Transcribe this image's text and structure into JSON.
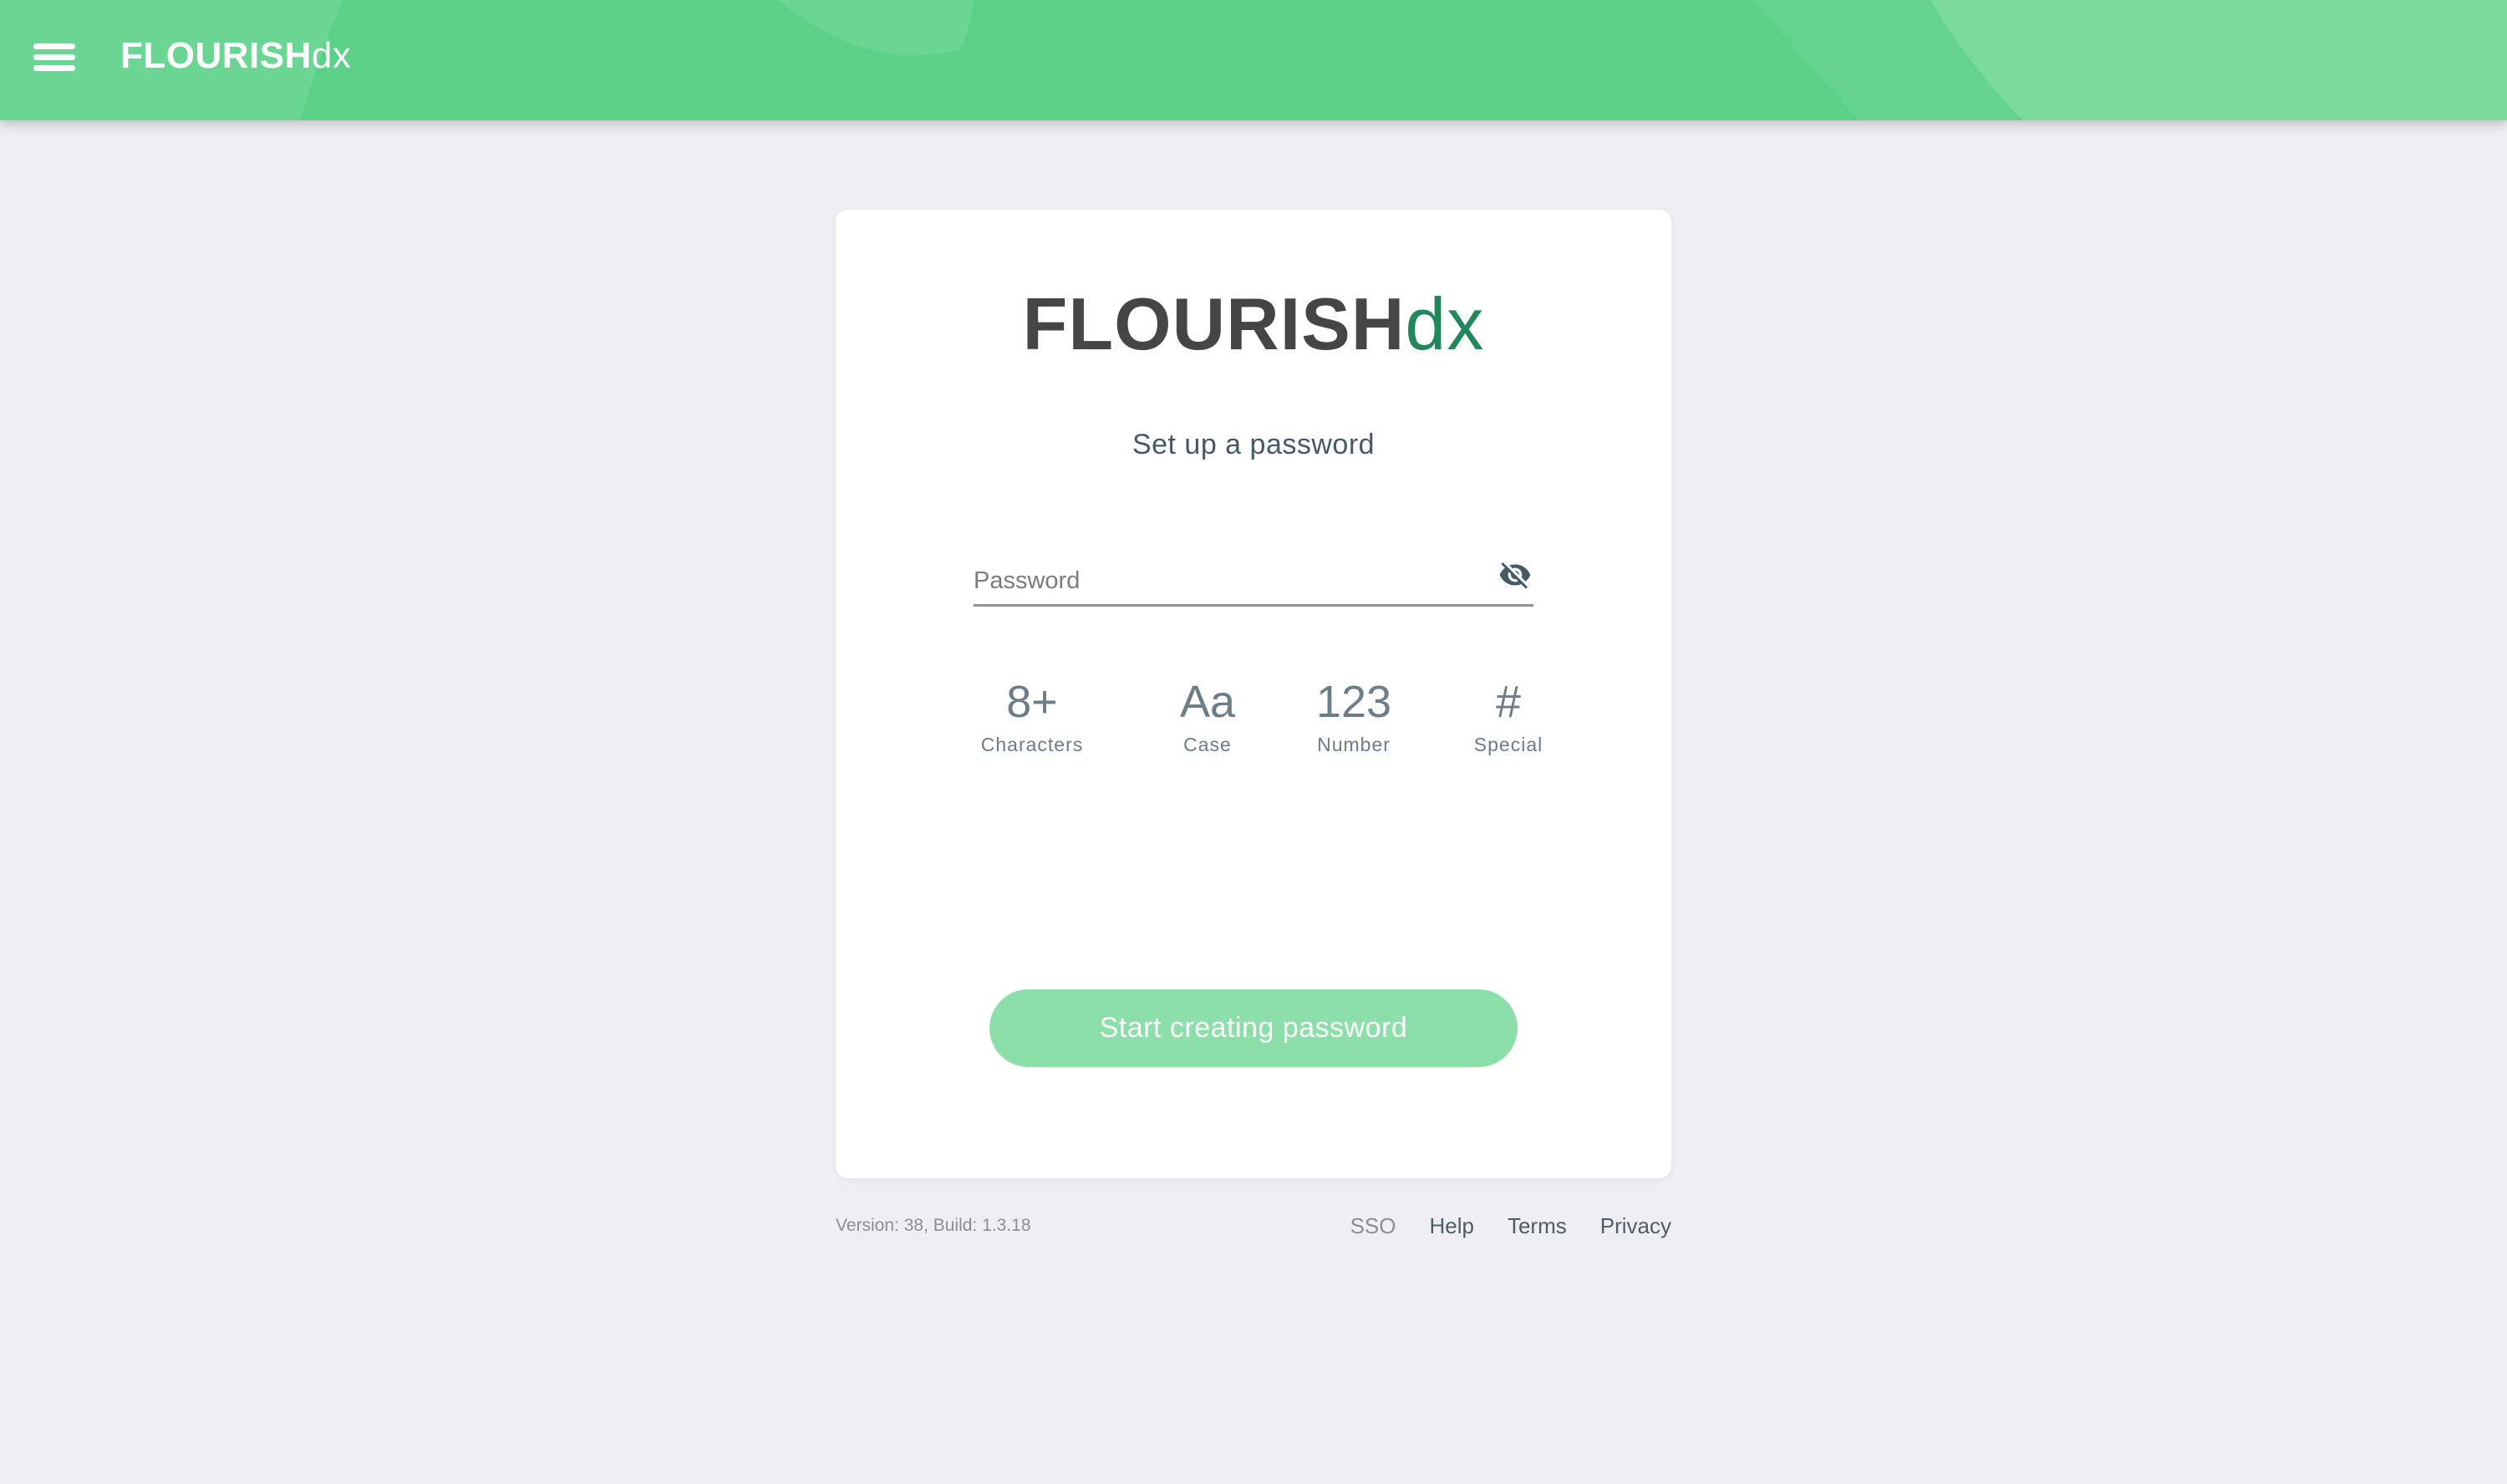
{
  "header": {
    "logo_bold": "FLOURISH",
    "logo_light": "dx",
    "menu_icon": "hamburger-menu-icon",
    "colors": {
      "base": "#5ad187",
      "blob_light": "#6bd693",
      "blob_lighter": "#7adb9c"
    }
  },
  "card": {
    "logo_bold": "FLOURISH",
    "logo_light": "dx",
    "logo_colors": {
      "bold": "#454545",
      "light": "#22875a"
    },
    "subtitle": "Set up a password",
    "password_field": {
      "placeholder": "Password",
      "value": "",
      "toggle_icon": "eye-off-icon"
    },
    "requirements": [
      {
        "symbol": "8+",
        "label": "Characters"
      },
      {
        "symbol": "Aa",
        "label": "Case"
      },
      {
        "symbol": "123",
        "label": "Number"
      },
      {
        "symbol": "#",
        "label": "Special"
      }
    ],
    "start_button": {
      "label": "Start creating password",
      "color": "#8ddfa9"
    }
  },
  "footer": {
    "version": "Version: 38, Build: 1.3.18",
    "links": [
      {
        "label": "SSO"
      },
      {
        "label": "Help"
      },
      {
        "label": "Terms"
      },
      {
        "label": "Privacy"
      }
    ]
  }
}
